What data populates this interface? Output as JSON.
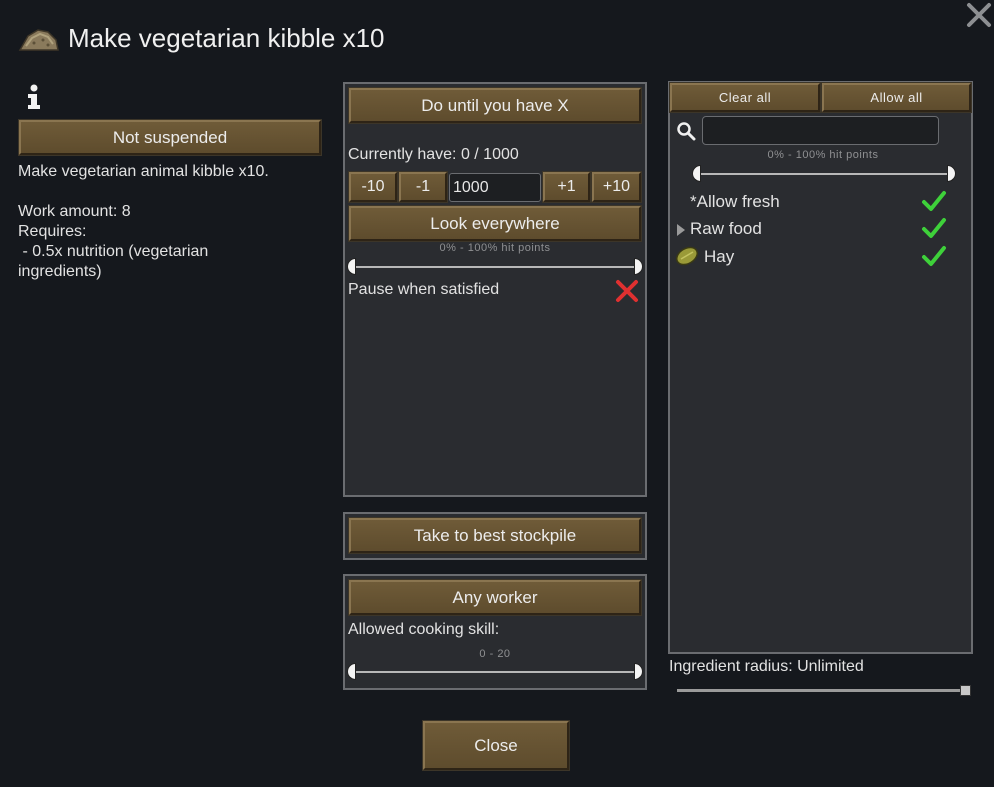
{
  "dialog": {
    "title": "Make vegetarian kibble x10",
    "close_label": "Close",
    "close_icon": "close-icon",
    "recipe_icon": "kibble-icon"
  },
  "left": {
    "info_icon": "info-icon",
    "suspend_label": "Not suspended",
    "description": "Make vegetarian animal kibble x10.",
    "work_amount": "Work amount: 8",
    "requires": "Requires:",
    "req_line1": " - 0.5x nutrition (vegetarian",
    "req_line2": "ingredients)"
  },
  "bill": {
    "repeat_mode": "Do until you have X",
    "currently_have": "Currently have: 0 / 1000",
    "minus10": "-10",
    "minus1": "-1",
    "target_value": "1000",
    "plus1": "+1",
    "plus10": "+10",
    "look_everywhere": "Look everywhere",
    "hitpoints_range": "0% - 100% hit points",
    "pause_label": "Pause when satisfied",
    "pause_enabled": false,
    "store_mode": "Take to best stockpile",
    "worker": "Any worker",
    "skill_label": "Allowed cooking skill:",
    "skill_range": "0 - 20"
  },
  "filter": {
    "clear_all": "Clear all",
    "allow_all": "Allow all",
    "search_icon": "search-icon",
    "search_value": "",
    "hitpoints_range": "0% - 100% hit points",
    "items": [
      {
        "label": "*Allow fresh",
        "allowed": true
      },
      {
        "label": "Raw food",
        "allowed": true,
        "expandable": true
      },
      {
        "label": "Hay",
        "allowed": true,
        "icon": "hay-icon"
      }
    ],
    "ingredient_radius": "Ingredient radius: Unlimited",
    "radius_level": 1.0
  },
  "colors": {
    "button": "#6f5b38",
    "check": "#3ed13a",
    "cross": "#e03030"
  }
}
